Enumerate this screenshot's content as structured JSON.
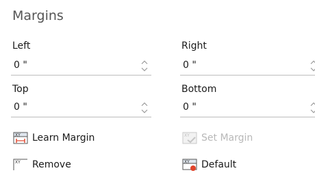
{
  "section": {
    "title": "Margins"
  },
  "fields": {
    "left": {
      "label": "Left",
      "value": "0 \""
    },
    "right": {
      "label": "Right",
      "value": "0 \""
    },
    "top": {
      "label": "Top",
      "value": "0 \""
    },
    "bottom": {
      "label": "Bottom",
      "value": "0 \""
    }
  },
  "buttons": {
    "learn_margin": {
      "label": "Learn Margin",
      "icon": "xy-learn-margin-icon"
    },
    "set_margin": {
      "label": "Set Margin",
      "icon": "xy-set-margin-icon",
      "enabled": false
    },
    "remove": {
      "label": "Remove",
      "icon": "xy-remove-icon"
    },
    "default": {
      "label": "Default",
      "icon": "xy-default-icon"
    }
  },
  "colors": {
    "accent_red": "#e0442c",
    "disabled_gray": "#b8b8b8"
  }
}
